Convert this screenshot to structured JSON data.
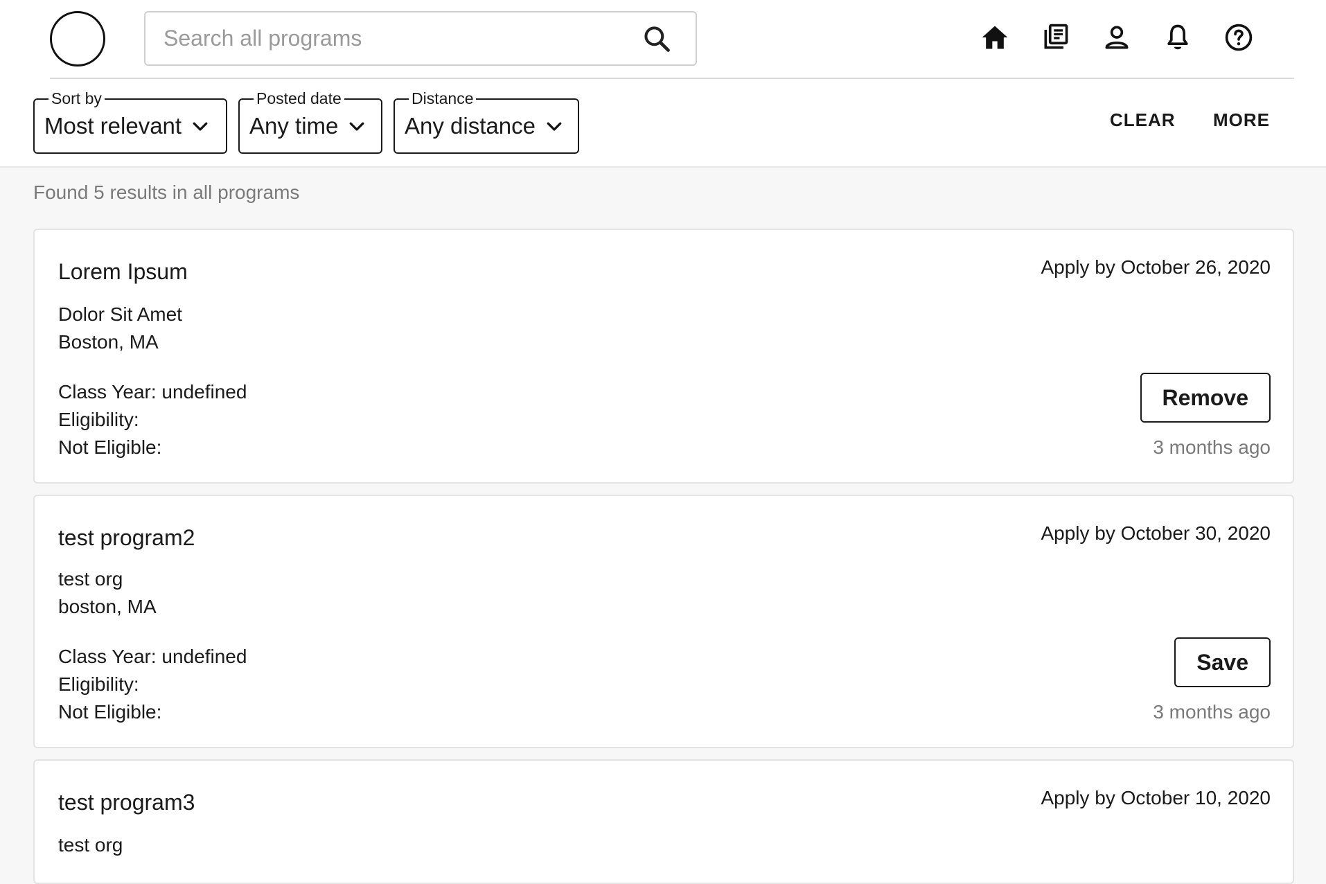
{
  "header": {
    "search": {
      "placeholder": "Search all programs",
      "value": ""
    },
    "nav": [
      {
        "icon": "home-icon"
      },
      {
        "icon": "library-icon"
      },
      {
        "icon": "profile-icon"
      },
      {
        "icon": "bell-icon"
      },
      {
        "icon": "help-icon"
      }
    ]
  },
  "filters": {
    "sort": {
      "label": "Sort by",
      "value": "Most relevant"
    },
    "posted": {
      "label": "Posted date",
      "value": "Any time"
    },
    "distance": {
      "label": "Distance",
      "value": "Any distance"
    },
    "clear_label": "CLEAR",
    "more_label": "MORE"
  },
  "results": {
    "summary": "Found 5 results in all programs",
    "cards": [
      {
        "title": "Lorem Ipsum",
        "org": "Dolor Sit Amet",
        "location": "Boston, MA",
        "class_year": "Class Year: undefined",
        "eligibility": "Eligibility:",
        "not_eligible": "Not Eligible:",
        "deadline": "Apply by October 26, 2020",
        "action": "Remove",
        "posted": "3 months ago"
      },
      {
        "title": "test program2",
        "org": "test org",
        "location": "boston, MA",
        "class_year": "Class Year: undefined",
        "eligibility": "Eligibility:",
        "not_eligible": "Not Eligible:",
        "deadline": "Apply by October 30, 2020",
        "action": "Save",
        "posted": "3 months ago"
      },
      {
        "title": "test program3",
        "org": "test org",
        "deadline": "Apply by October 10, 2020"
      }
    ]
  }
}
